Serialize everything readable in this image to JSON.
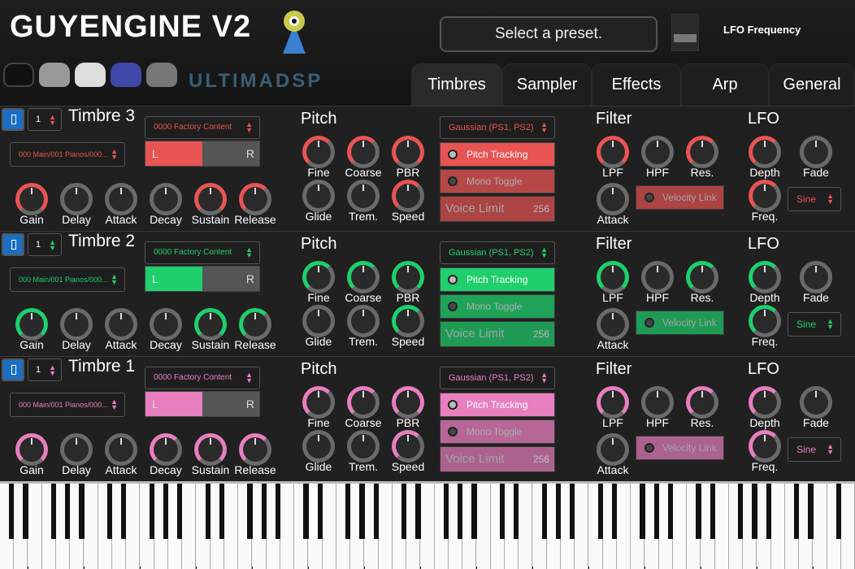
{
  "app": {
    "title": "GUYENGINE V2",
    "brand": "ULTIMADSP"
  },
  "header": {
    "preset_placeholder": "Select a preset.",
    "lfo_label": "LFO Frequency"
  },
  "tabs": [
    {
      "label": "Timbres"
    },
    {
      "label": "Sampler"
    },
    {
      "label": "Effects"
    },
    {
      "label": "Arp"
    },
    {
      "label": "General"
    }
  ],
  "colors": {
    "red": "#e85454",
    "green": "#1fcf6d",
    "pink": "#e87fbf"
  },
  "timbres": [
    {
      "name": "Timbre 3",
      "channel": "1",
      "bank": "0000 Factory Content",
      "patch": "000 Main/001 Pianos/000...",
      "pan_l": "L",
      "pan_r": "R",
      "pitch": "Pitch",
      "interp": "Gaussian (PS1, PS2)",
      "pitch_tracking": "Pitch Tracking",
      "mono_toggle": "Mono Toggle",
      "voice_limit_label": "Voice Limit",
      "voice_limit": "256",
      "filter": "Filter",
      "lfo": "LFO",
      "velocity_link": "Velocity Link",
      "lfo_wave": "Sine",
      "knobs": {
        "gain": "Gain",
        "delay": "Delay",
        "attack": "Attack",
        "decay": "Decay",
        "sustain": "Sustain",
        "release": "Release",
        "fine": "Fine",
        "coarse": "Coarse",
        "pbr": "PBR",
        "glide": "Glide",
        "trem": "Trem.",
        "speed": "Speed",
        "lpf": "LPF",
        "hpf": "HPF",
        "res": "Res.",
        "fattack": "Attack",
        "depth": "Depth",
        "fade": "Fade",
        "freq": "Freq."
      }
    },
    {
      "name": "Timbre 2",
      "channel": "1",
      "bank": "0000 Factory Content",
      "patch": "000 Main/001 Pianos/000...",
      "pan_l": "L",
      "pan_r": "R",
      "pitch": "Pitch",
      "interp": "Gaussian (PS1, PS2)",
      "pitch_tracking": "Pitch Tracking",
      "mono_toggle": "Mono Toggle",
      "voice_limit_label": "Voice Limit",
      "voice_limit": "256",
      "filter": "Filter",
      "lfo": "LFO",
      "velocity_link": "Velocity Link",
      "lfo_wave": "Sine",
      "knobs": {
        "gain": "Gain",
        "delay": "Delay",
        "attack": "Attack",
        "decay": "Decay",
        "sustain": "Sustain",
        "release": "Release",
        "fine": "Fine",
        "coarse": "Coarse",
        "pbr": "PBR",
        "glide": "Glide",
        "trem": "Trem.",
        "speed": "Speed",
        "lpf": "LPF",
        "hpf": "HPF",
        "res": "Res.",
        "fattack": "Attack",
        "depth": "Depth",
        "fade": "Fade",
        "freq": "Freq."
      }
    },
    {
      "name": "Timbre 1",
      "channel": "1",
      "bank": "0000 Factory Content",
      "patch": "000 Main/001 Pianos/000...",
      "pan_l": "L",
      "pan_r": "R",
      "pitch": "Pitch",
      "interp": "Gaussian (PS1, PS2)",
      "pitch_tracking": "Pitch Tracking",
      "mono_toggle": "Mono Toggle",
      "voice_limit_label": "Voice Limit",
      "voice_limit": "256",
      "filter": "Filter",
      "lfo": "LFO",
      "velocity_link": "Velocity Link",
      "lfo_wave": "Sine",
      "knobs": {
        "gain": "Gain",
        "delay": "Delay",
        "attack": "Attack",
        "decay": "Decay",
        "sustain": "Sustain",
        "release": "Release",
        "fine": "Fine",
        "coarse": "Coarse",
        "pbr": "PBR",
        "glide": "Glide",
        "trem": "Trem.",
        "speed": "Speed",
        "lpf": "LPF",
        "hpf": "HPF",
        "res": "Res.",
        "fattack": "Attack",
        "depth": "Depth",
        "fade": "Fade",
        "freq": "Freq."
      }
    }
  ]
}
